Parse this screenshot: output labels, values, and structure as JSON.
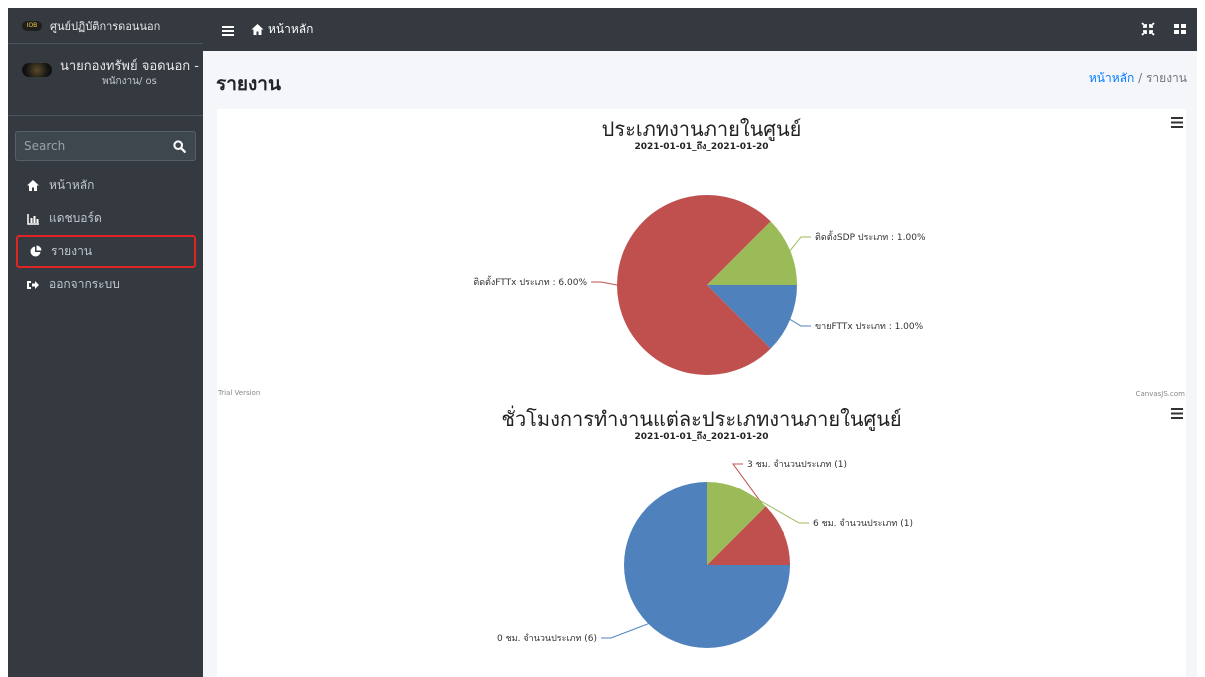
{
  "brand": {
    "logo_text": "IOB",
    "name": "ศูนย์ปฏิบัติการดอนนอก"
  },
  "user": {
    "name": "นายกองทรัพย์ จอดนอก -",
    "role": "พนักงาน/ os"
  },
  "search": {
    "placeholder": "Search"
  },
  "nav": [
    {
      "label": "หน้าหลัก",
      "icon": "home-icon"
    },
    {
      "label": "แดชบอร์ด",
      "icon": "bar-chart-icon"
    },
    {
      "label": "รายงาน",
      "icon": "pie-chart-icon"
    },
    {
      "label": "ออกจากระบบ",
      "icon": "sign-out-icon"
    }
  ],
  "topbar": {
    "home_label": "หน้าหลัก"
  },
  "page": {
    "title": "รายงาน"
  },
  "breadcrumb": {
    "home": "หน้าหลัก",
    "separator": "/",
    "current": "รายงาน"
  },
  "watermarks": {
    "left": "Trial Version",
    "right": "CanvasJS.com"
  },
  "colors": {
    "sidebar": "#343a40",
    "accent": "#007bff",
    "highlight": "#e02424"
  },
  "chart_data": [
    {
      "type": "pie",
      "title": "ประเภทงานภายในศูนย์",
      "subtitle": "2021-01-01_ถึง_2021-01-20",
      "slices": [
        {
          "label": "ติดตั้งSDP ประเภท : 1.00%",
          "value": 1,
          "color": "#9bbb59"
        },
        {
          "label": "ขายFTTx ประเภท : 1.00%",
          "value": 1,
          "color": "#4f81bc"
        },
        {
          "label": "ติดตั้งFTTx ประเภท : 6.00%",
          "value": 6,
          "color": "#c0504e"
        }
      ]
    },
    {
      "type": "pie",
      "title": "ชั่วโมงการทำงานแต่ละประเภทงานภายในศูนย์",
      "subtitle": "2021-01-01_ถึง_2021-01-20",
      "slices": [
        {
          "label": "0 ชม. จำนวนประเภท (6)",
          "value": 6,
          "color": "#4f81bc"
        },
        {
          "label": "3 ชม. จำนวนประเภท (1)",
          "value": 1,
          "color": "#c0504e"
        },
        {
          "label": "6 ชม. จำนวนประเภท (1)",
          "value": 1,
          "color": "#9bbb59"
        }
      ]
    }
  ]
}
